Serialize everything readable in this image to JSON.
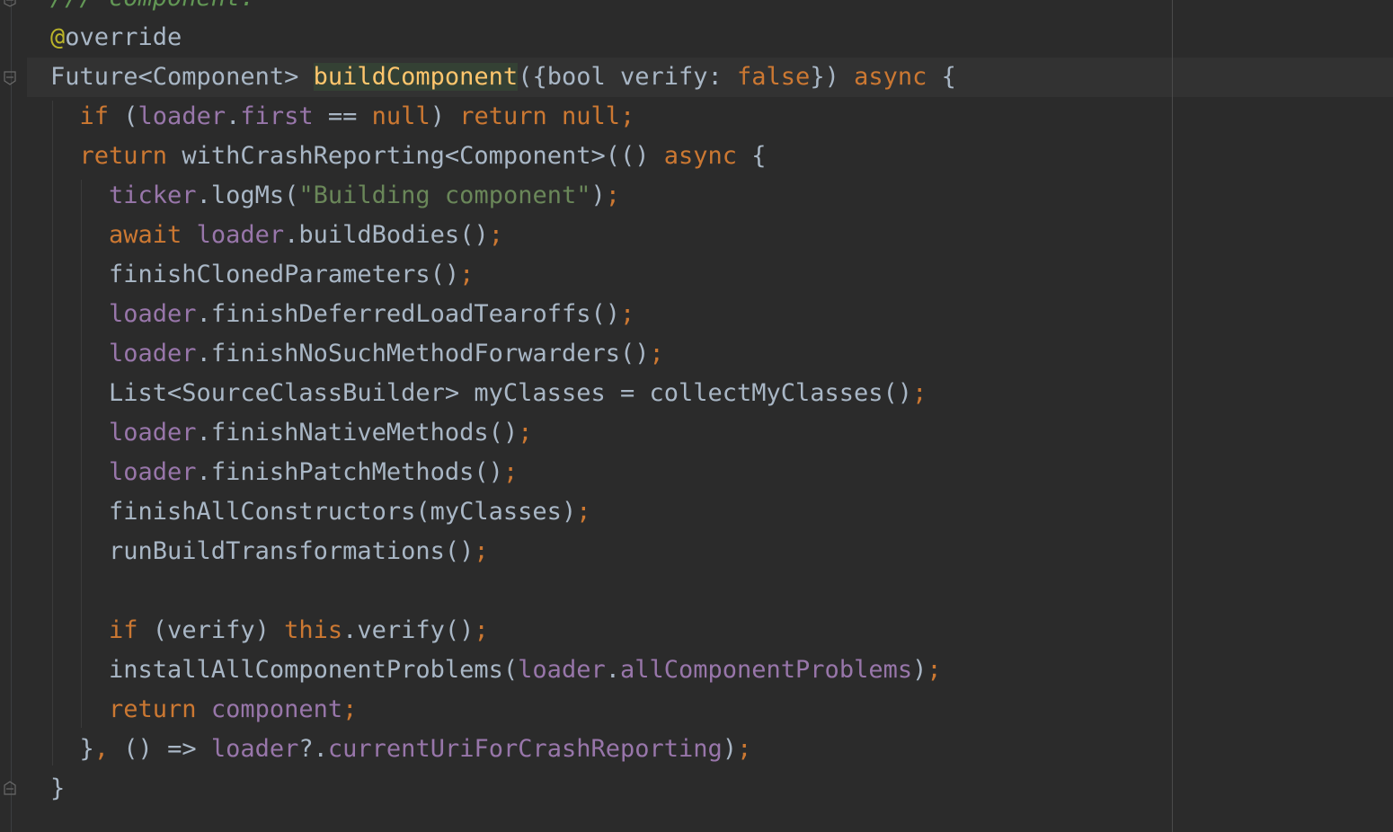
{
  "editor": {
    "lines": [
      [
        {
          "t": "/// component.",
          "c": "cmt"
        }
      ],
      [
        {
          "t": "@",
          "c": "ann"
        },
        {
          "t": "override",
          "c": "plain"
        }
      ],
      [
        {
          "t": "Future<Component> ",
          "c": "plain"
        },
        {
          "t": "buildComponent",
          "c": "decl"
        },
        {
          "t": "({bool verify: ",
          "c": "plain"
        },
        {
          "t": "false",
          "c": "kw"
        },
        {
          "t": "}) ",
          "c": "plain"
        },
        {
          "t": "async",
          "c": "kw"
        },
        {
          "t": " {",
          "c": "plain"
        }
      ],
      [
        {
          "t": "  ",
          "c": "plain"
        },
        {
          "t": "if",
          "c": "kw"
        },
        {
          "t": " (",
          "c": "plain"
        },
        {
          "t": "loader",
          "c": "fld"
        },
        {
          "t": ".",
          "c": "plain"
        },
        {
          "t": "first",
          "c": "fld"
        },
        {
          "t": " == ",
          "c": "plain"
        },
        {
          "t": "null",
          "c": "kw"
        },
        {
          "t": ") ",
          "c": "plain"
        },
        {
          "t": "return null",
          "c": "kw"
        },
        {
          "t": ";",
          "c": "kw"
        }
      ],
      [
        {
          "t": "  ",
          "c": "plain"
        },
        {
          "t": "return",
          "c": "kw"
        },
        {
          "t": " withCrashReporting<Component>(() ",
          "c": "plain"
        },
        {
          "t": "async",
          "c": "kw"
        },
        {
          "t": " {",
          "c": "plain"
        }
      ],
      [
        {
          "t": "    ",
          "c": "plain"
        },
        {
          "t": "ticker",
          "c": "fld"
        },
        {
          "t": ".logMs(",
          "c": "plain"
        },
        {
          "t": "\"Building component\"",
          "c": "str"
        },
        {
          "t": ")",
          "c": "plain"
        },
        {
          "t": ";",
          "c": "kw"
        }
      ],
      [
        {
          "t": "    ",
          "c": "plain"
        },
        {
          "t": "await",
          "c": "kw"
        },
        {
          "t": " ",
          "c": "plain"
        },
        {
          "t": "loader",
          "c": "fld"
        },
        {
          "t": ".buildBodies()",
          "c": "plain"
        },
        {
          "t": ";",
          "c": "kw"
        }
      ],
      [
        {
          "t": "    finishClonedParameters()",
          "c": "plain"
        },
        {
          "t": ";",
          "c": "kw"
        }
      ],
      [
        {
          "t": "    ",
          "c": "plain"
        },
        {
          "t": "loader",
          "c": "fld"
        },
        {
          "t": ".finishDeferredLoadTearoffs()",
          "c": "plain"
        },
        {
          "t": ";",
          "c": "kw"
        }
      ],
      [
        {
          "t": "    ",
          "c": "plain"
        },
        {
          "t": "loader",
          "c": "fld"
        },
        {
          "t": ".finishNoSuchMethodForwarders()",
          "c": "plain"
        },
        {
          "t": ";",
          "c": "kw"
        }
      ],
      [
        {
          "t": "    List<SourceClassBuilder> myClasses = collectMyClasses()",
          "c": "plain"
        },
        {
          "t": ";",
          "c": "kw"
        }
      ],
      [
        {
          "t": "    ",
          "c": "plain"
        },
        {
          "t": "loader",
          "c": "fld"
        },
        {
          "t": ".finishNativeMethods()",
          "c": "plain"
        },
        {
          "t": ";",
          "c": "kw"
        }
      ],
      [
        {
          "t": "    ",
          "c": "plain"
        },
        {
          "t": "loader",
          "c": "fld"
        },
        {
          "t": ".finishPatchMethods()",
          "c": "plain"
        },
        {
          "t": ";",
          "c": "kw"
        }
      ],
      [
        {
          "t": "    finishAllConstructors(myClasses)",
          "c": "plain"
        },
        {
          "t": ";",
          "c": "kw"
        }
      ],
      [
        {
          "t": "    runBuildTransformations()",
          "c": "plain"
        },
        {
          "t": ";",
          "c": "kw"
        }
      ],
      [
        {
          "t": "",
          "c": "plain"
        }
      ],
      [
        {
          "t": "    ",
          "c": "plain"
        },
        {
          "t": "if",
          "c": "kw"
        },
        {
          "t": " (verify) ",
          "c": "plain"
        },
        {
          "t": "this",
          "c": "kw"
        },
        {
          "t": ".verify()",
          "c": "plain"
        },
        {
          "t": ";",
          "c": "kw"
        }
      ],
      [
        {
          "t": "    installAllComponentProblems(",
          "c": "plain"
        },
        {
          "t": "loader",
          "c": "fld"
        },
        {
          "t": ".",
          "c": "plain"
        },
        {
          "t": "allComponentProblems",
          "c": "fld"
        },
        {
          "t": ")",
          "c": "plain"
        },
        {
          "t": ";",
          "c": "kw"
        }
      ],
      [
        {
          "t": "    ",
          "c": "plain"
        },
        {
          "t": "return",
          "c": "kw"
        },
        {
          "t": " ",
          "c": "plain"
        },
        {
          "t": "component",
          "c": "fld"
        },
        {
          "t": ";",
          "c": "kw"
        }
      ],
      [
        {
          "t": "  }",
          "c": "plain"
        },
        {
          "t": ",",
          "c": "kw"
        },
        {
          "t": " () => ",
          "c": "plain"
        },
        {
          "t": "loader",
          "c": "fld"
        },
        {
          "t": "?.",
          "c": "plain"
        },
        {
          "t": "currentUriForCrashReporting",
          "c": "fld"
        },
        {
          "t": ")",
          "c": "plain"
        },
        {
          "t": ";",
          "c": "kw"
        }
      ],
      [
        {
          "t": "}",
          "c": "plain"
        }
      ]
    ]
  },
  "colors": {
    "background": "#2b2b2b",
    "keyword": "#cc7832",
    "field": "#9876aa",
    "string": "#6a8759",
    "annotation": "#bbb529",
    "comment": "#629755",
    "text": "#a9b7c6",
    "declaration": "#ffc66d"
  }
}
